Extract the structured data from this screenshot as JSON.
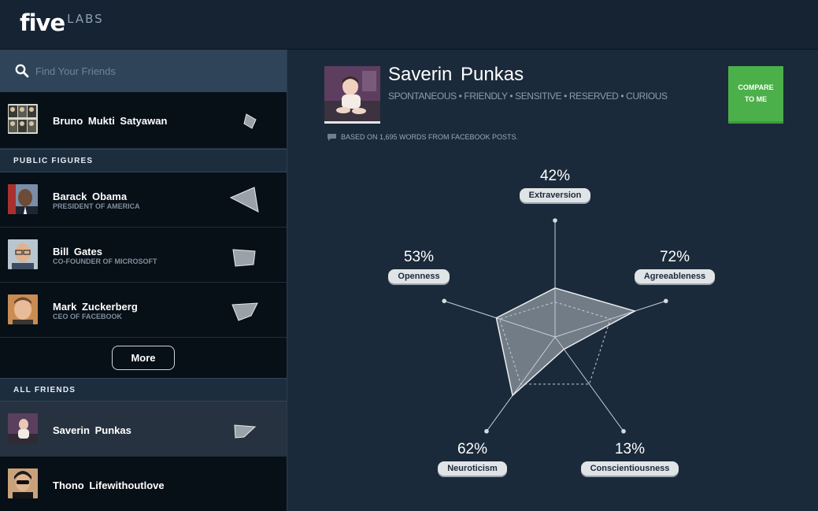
{
  "logo": {
    "main": "five",
    "sub": "LABS"
  },
  "search": {
    "placeholder": "Find Your Friends"
  },
  "sections": {
    "public_figures": "PUBLIC FIGURES",
    "all_friends": "ALL FRIENDS"
  },
  "top_friend": {
    "name": "Bruno Mukti Satyawan"
  },
  "public_figures": [
    {
      "name": "Barack Obama",
      "role": "PRESIDENT OF AMERICA"
    },
    {
      "name": "Bill Gates",
      "role": "CO-FOUNDER OF MICROSOFT"
    },
    {
      "name": "Mark Zuckerberg",
      "role": "CEO OF FACEBOOK"
    }
  ],
  "more_button": "More",
  "friends": [
    {
      "name": "Saverin Punkas"
    },
    {
      "name": "Thono Lifewithoutlove"
    }
  ],
  "profile": {
    "name": "Saverin Punkas",
    "traits": "SPONTANEOUS • FRIENDLY • SENSITIVE • RESERVED • CURIOUS",
    "compare_line1": "COMPARE",
    "compare_line2": "TO ME",
    "basis": "BASED ON 1,695 WORDS FROM FACEBOOK POSTS."
  },
  "chart_data": {
    "type": "radar",
    "axes": [
      "Extraversion",
      "Agreeableness",
      "Conscientiousness",
      "Neuroticism",
      "Openness"
    ],
    "values": [
      42,
      72,
      13,
      62,
      53
    ],
    "value_labels": [
      "42%",
      "72%",
      "13%",
      "62%",
      "53%"
    ],
    "range": [
      0,
      100
    ],
    "reference_outline": [
      30,
      50,
      50,
      50,
      50
    ]
  },
  "colors": {
    "accent_green": "#4cb04a",
    "background": "#1b2a3a",
    "sidebar": "#0d1822"
  }
}
